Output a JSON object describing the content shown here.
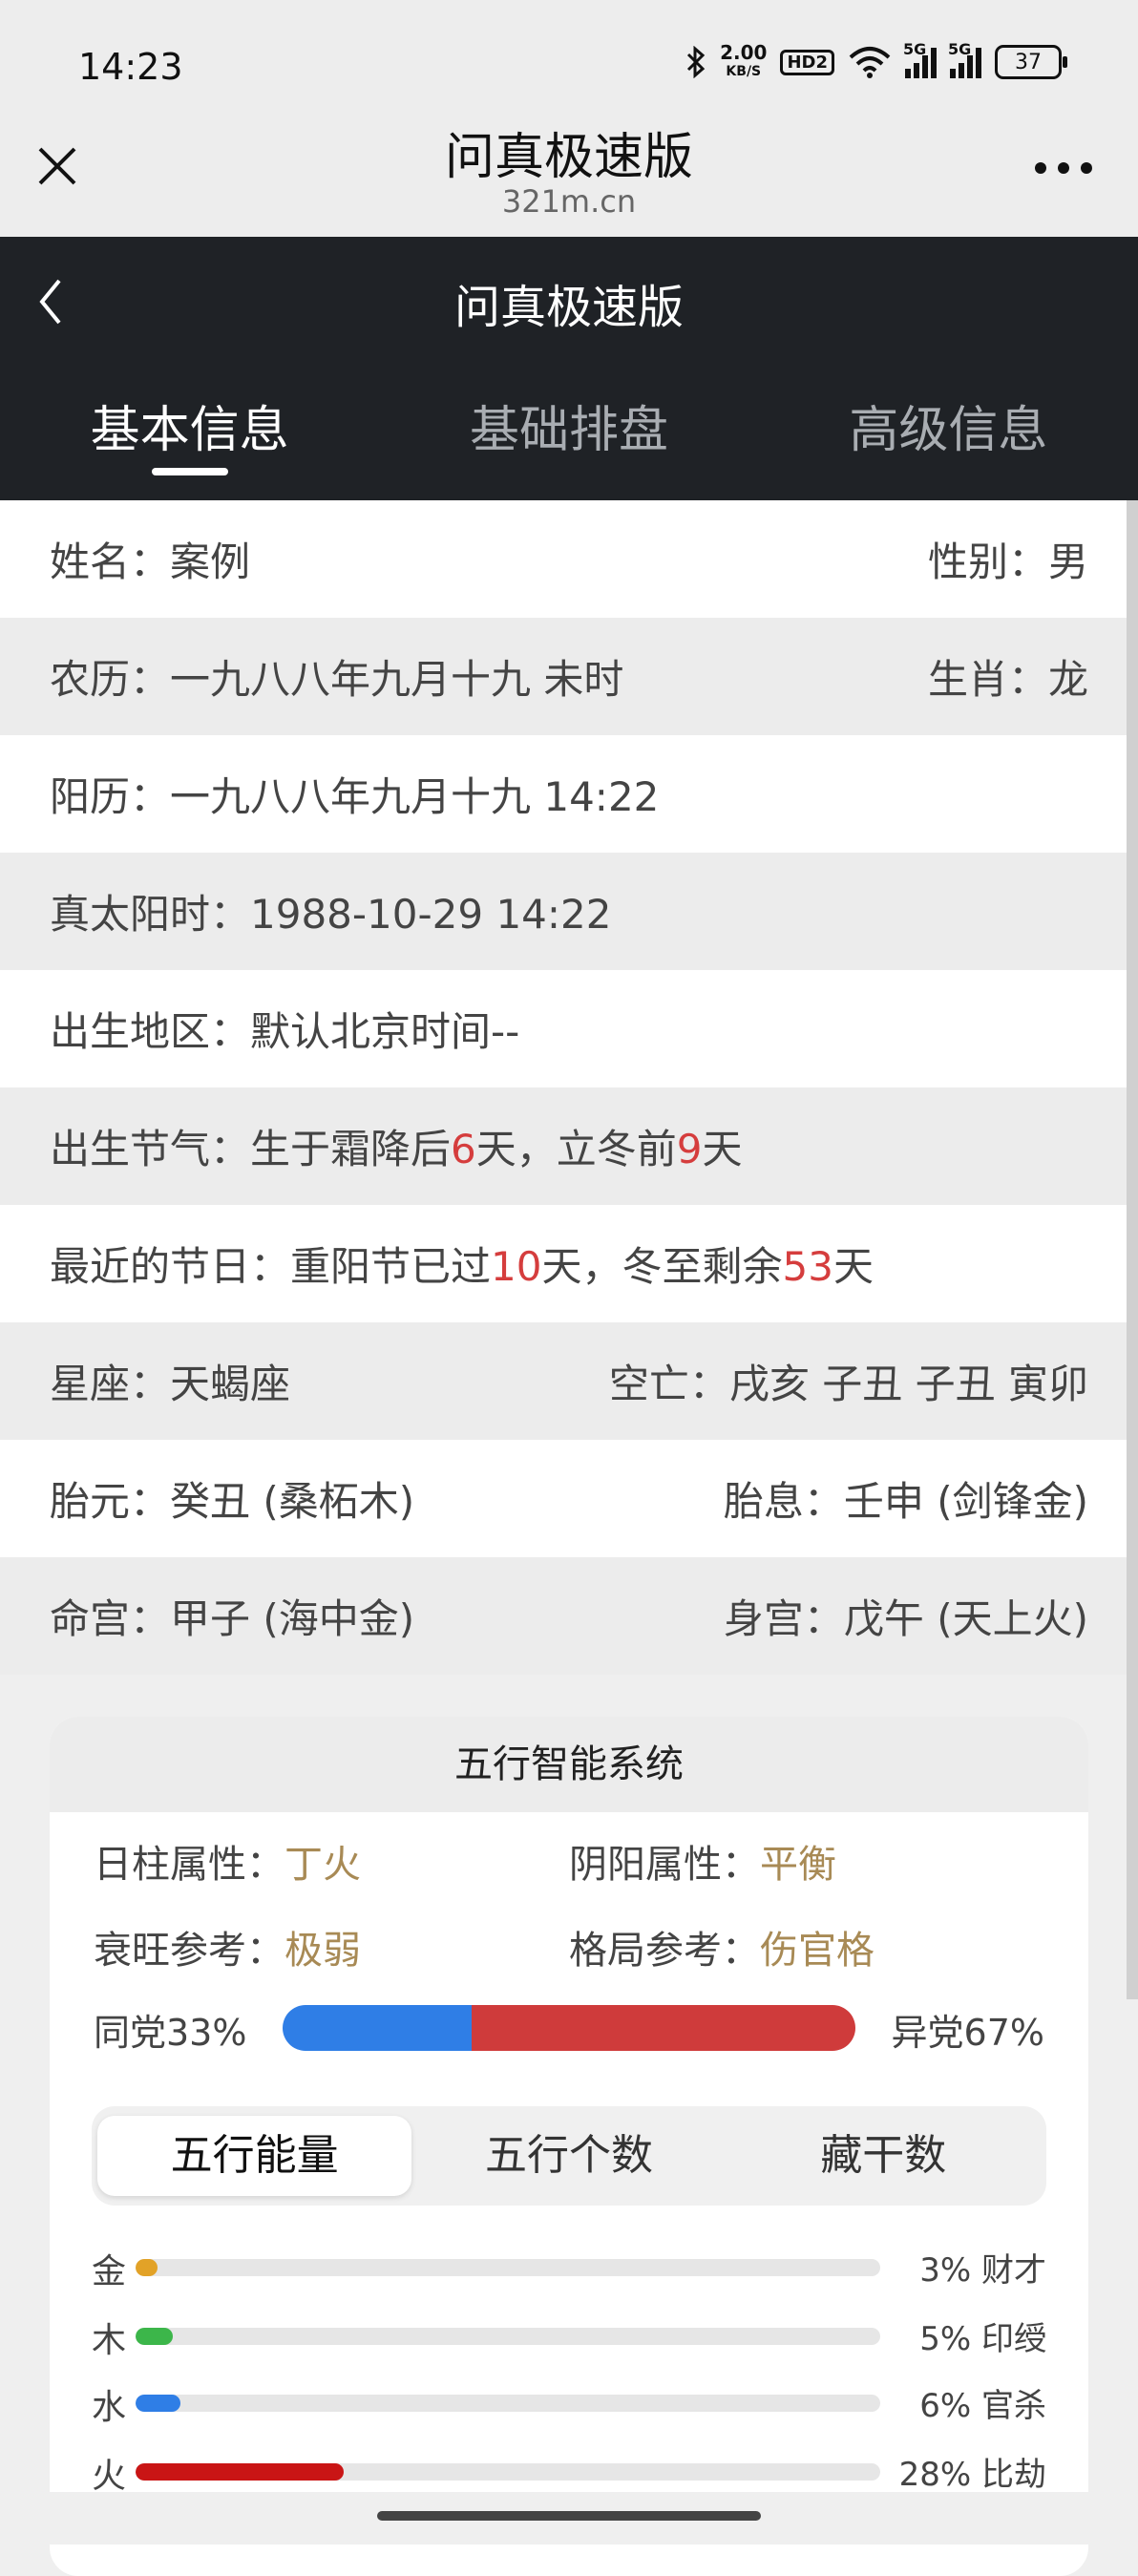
{
  "status_bar": {
    "time": "14:23",
    "speed_value": "2.00",
    "speed_unit": "KB/S",
    "hd": "HD2",
    "signal1_label": "5G",
    "signal2_label": "5G",
    "battery": "37"
  },
  "header": {
    "title": "问真极速版",
    "subtitle": "321m.cn",
    "close_icon": "close-icon",
    "more_icon": "more-icon"
  },
  "page": {
    "title": "问真极速版",
    "back_icon": "chevron-left-icon",
    "tabs": [
      {
        "label": "基本信息",
        "active": true
      },
      {
        "label": "基础排盘",
        "active": false
      },
      {
        "label": "高级信息",
        "active": false
      }
    ]
  },
  "info": {
    "name_label": "姓名：",
    "name": "案例",
    "gender_label": "性别：",
    "gender": "男",
    "lunar_label": "农历：",
    "lunar": "一九八八年九月十九 未时",
    "zodiac_label": "生肖：",
    "zodiac": "龙",
    "solar_label": "阳历：",
    "solar": "一九八八年九月十九 14:22",
    "true_solar_label": "真太阳时：",
    "true_solar": "1988-10-29 14:22",
    "region_label": "出生地区：",
    "region": "默认北京时间--",
    "solar_term_label": "出生节气：",
    "solar_term_a": "生于霜降后",
    "solar_term_n1": "6",
    "solar_term_b": "天，立冬前",
    "solar_term_n2": "9",
    "solar_term_c": "天",
    "festival_label": "最近的节日：",
    "festival_a": "重阳节已过",
    "festival_n1": "10",
    "festival_b": "天，冬至剩余",
    "festival_n2": "53",
    "festival_c": "天",
    "constellation_label": "星座：",
    "constellation": "天蝎座",
    "kongwang_label": "空亡：",
    "kongwang": "戌亥 子丑 子丑 寅卯",
    "taiyuan_label": "胎元：",
    "taiyuan": "癸丑 (桑柘木)",
    "taixi_label": "胎息：",
    "taixi": "壬申 (剑锋金)",
    "minggong_label": "命宫：",
    "minggong": "甲子 (海中金)",
    "shengong_label": "身宫：",
    "shengong": "戊午 (天上火)"
  },
  "wuxing": {
    "title": "五行智能系统",
    "day_pillar_label": "日柱属性：",
    "day_pillar": "丁火",
    "yinyang_label": "阴阳属性：",
    "yinyang": "平衡",
    "strength_label": "衰旺参考：",
    "strength": "极弱",
    "pattern_label": "格局参考：",
    "pattern": "伤官格",
    "same_party": "同党33%",
    "diff_party": "异党67%",
    "same_party_value": 33,
    "diff_party_value": 67,
    "segments": [
      {
        "label": "五行能量",
        "active": true
      },
      {
        "label": "五行个数",
        "active": false
      },
      {
        "label": "藏干数",
        "active": false
      }
    ],
    "elements": [
      {
        "name": "金",
        "value": 3,
        "pct": "3% 财才",
        "color": "#e2a227"
      },
      {
        "name": "木",
        "value": 5,
        "pct": "5% 印绶",
        "color": "#3cb64a"
      },
      {
        "name": "水",
        "value": 6,
        "pct": "6% 官杀",
        "color": "#2f7ee6"
      },
      {
        "name": "火",
        "value": 28,
        "pct": "28% 比劫",
        "color": "#c91515"
      }
    ]
  }
}
